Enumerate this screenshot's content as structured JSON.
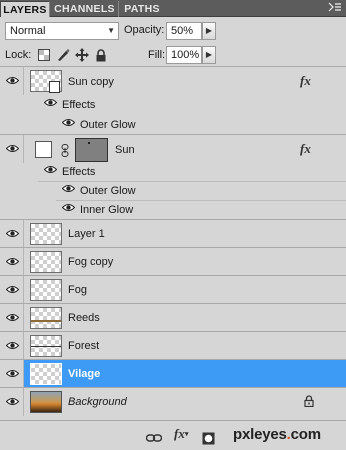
{
  "tabs": [
    {
      "label": "LAYERS"
    },
    {
      "label": "CHANNELS"
    },
    {
      "label": "PATHS"
    }
  ],
  "panel_menu_icon": "panel-menu-icon",
  "blend_mode": {
    "value": "Normal"
  },
  "opacity": {
    "label": "Opacity:",
    "value": "50%"
  },
  "lock": {
    "label": "Lock:"
  },
  "fill": {
    "label": "Fill:",
    "value": "100%"
  },
  "layers": [
    {
      "name": "Sun copy",
      "effects_label": "Effects",
      "effects": [
        "Outer Glow"
      ],
      "has_fx": true
    },
    {
      "name": "Sun",
      "effects_label": "Effects",
      "effects": [
        "Outer Glow",
        "Inner Glow"
      ],
      "has_fx": true
    },
    {
      "name": "Layer 1"
    },
    {
      "name": "Fog copy"
    },
    {
      "name": "Fog"
    },
    {
      "name": "Reeds"
    },
    {
      "name": "Forest"
    },
    {
      "name": "Vilage",
      "selected": true
    },
    {
      "name": "Background",
      "locked": true
    }
  ],
  "fx_symbol": "fx",
  "watermark": {
    "text": "pxleyes",
    "dot": ".",
    "suffix": "com"
  },
  "colors": {
    "selected": "#3d9bf5",
    "panel": "#d6d6d6",
    "tabbar": "#5c5c5c"
  }
}
